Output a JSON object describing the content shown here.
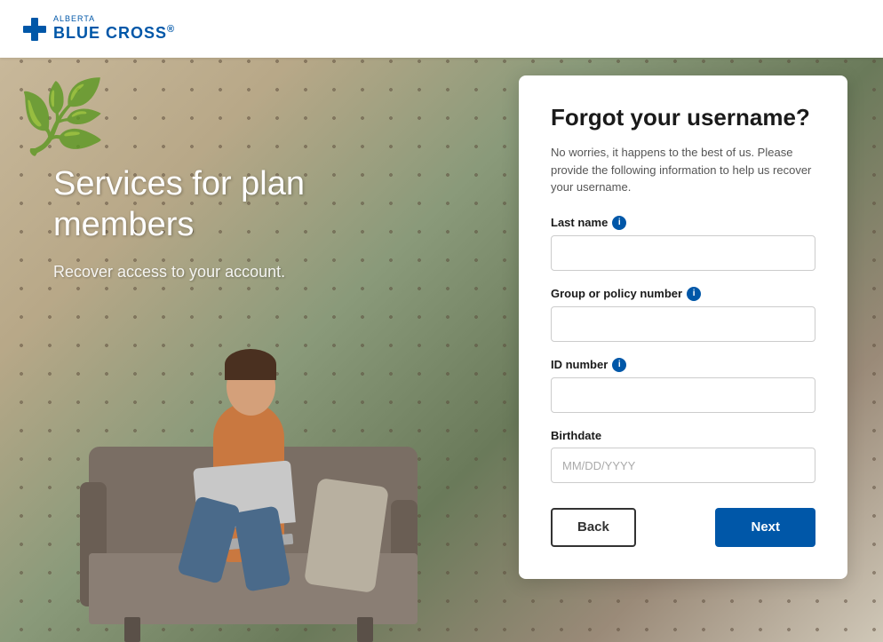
{
  "header": {
    "logo_alberta": "ALBERTA",
    "logo_blue_cross": "BLUE CROSS",
    "logo_registered": "®"
  },
  "hero": {
    "heading_line1": "Services for plan",
    "heading_line2": "members",
    "subtext": "Recover access to your account."
  },
  "form": {
    "title": "Forgot your username?",
    "description": "No worries, it happens to the best of us. Please provide the following information to help us recover your username.",
    "fields": {
      "last_name": {
        "label": "Last name",
        "placeholder": ""
      },
      "group_policy": {
        "label": "Group or policy number",
        "placeholder": ""
      },
      "id_number": {
        "label": "ID number",
        "placeholder": ""
      },
      "birthdate": {
        "label": "Birthdate",
        "placeholder": "MM/DD/YYYY"
      }
    },
    "buttons": {
      "back": "Back",
      "next": "Next"
    }
  }
}
